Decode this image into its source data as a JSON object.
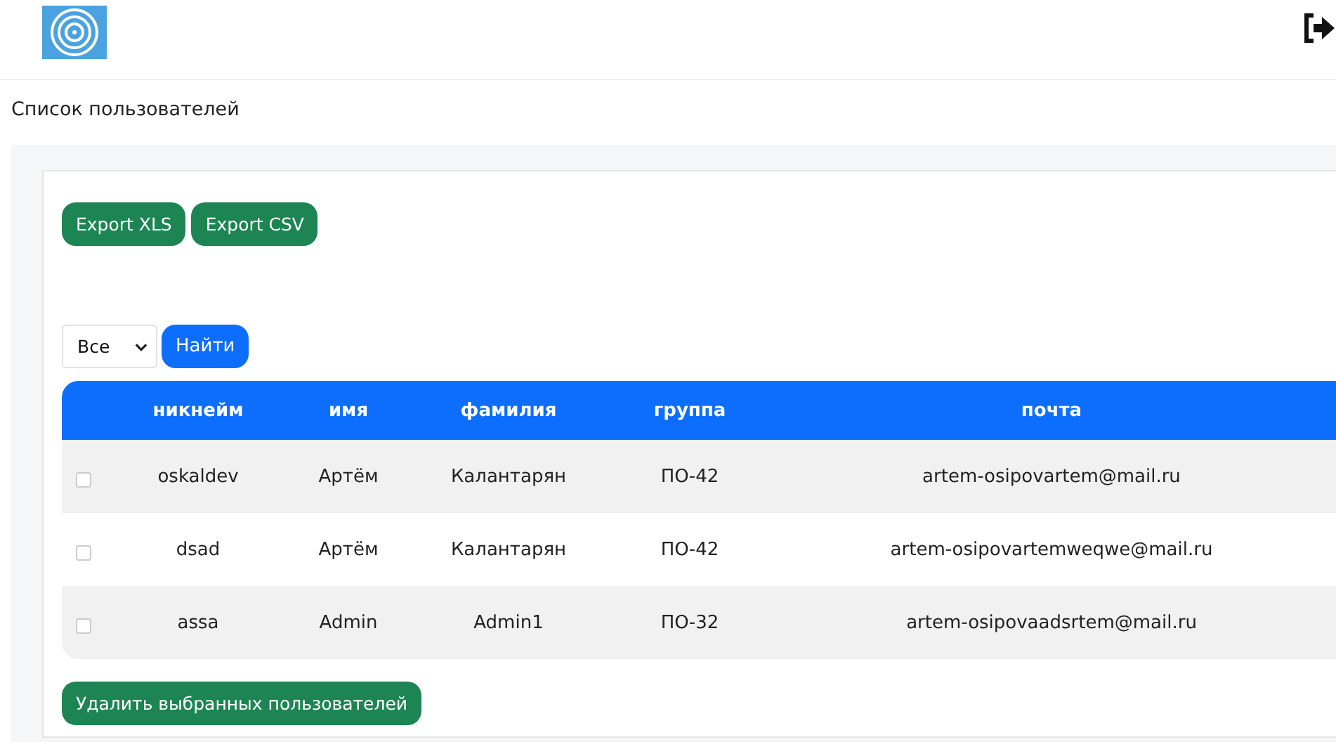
{
  "header": {
    "title": "Список пользователей"
  },
  "export_buttons": [
    "Export XLS",
    "Export CSV"
  ],
  "filter": {
    "value": "Все",
    "button": "Найти"
  },
  "table": {
    "columns": [
      "никнейм",
      "имя",
      "фамилия",
      "группа",
      "почта"
    ],
    "rows": [
      {
        "checked": false,
        "cells": [
          "oskaldev",
          "Артём",
          "Калантарян",
          "ПО-42",
          "artem-osipovartem@mail.ru"
        ]
      },
      {
        "checked": false,
        "cells": [
          "dsad",
          "Артём",
          "Калантарян",
          "ПО-42",
          "artem-osipovartemweqwe@mail.ru"
        ]
      },
      {
        "checked": false,
        "cells": [
          "assa",
          "Admin",
          "Admin1",
          "ПО-32",
          "artem-osipovaadsrtem@mail.ru"
        ]
      }
    ]
  },
  "delete_button": "Удалить выбранных пользователей"
}
